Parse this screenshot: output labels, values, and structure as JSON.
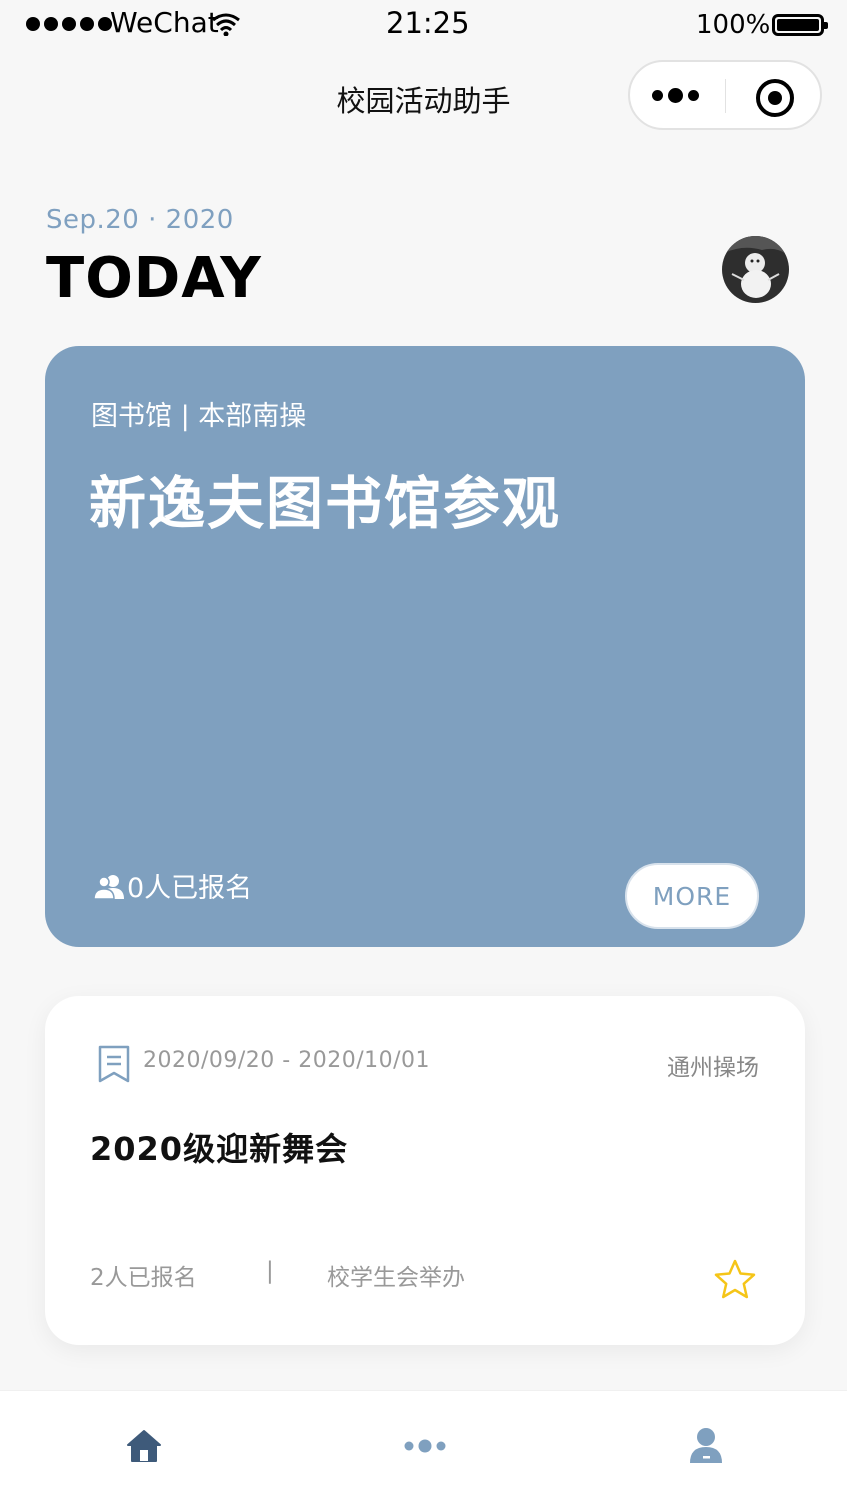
{
  "status_bar": {
    "carrier": "WeChat",
    "time": "21:25",
    "battery": "100%"
  },
  "nav": {
    "title": "校园活动助手",
    "menu_icon": "more-dots-icon",
    "close_icon": "target-close-icon"
  },
  "header": {
    "date": "Sep.20 · 2020",
    "heading": "TODAY",
    "avatar_icon": "user-avatar"
  },
  "featured": {
    "tag": "图书馆 | 本部南操",
    "title": "新逸夫图书馆参观",
    "count": "0人已报名",
    "more_label": "MORE",
    "color": "#7fa0bf"
  },
  "event": {
    "date_range": "2020/09/20 - 2020/10/01",
    "location": "通州操场",
    "title": "2020级迎新舞会",
    "count": "2人已报名",
    "divider": "|",
    "organizer": "校学生会举办",
    "star_color": "#f5c518"
  },
  "tabbar": {
    "items": [
      {
        "icon": "home-icon",
        "color": "#3e5a7a"
      },
      {
        "icon": "dots-icon",
        "color": "#7fa0bf"
      },
      {
        "icon": "user-icon",
        "color": "#7fa0bf"
      }
    ]
  }
}
